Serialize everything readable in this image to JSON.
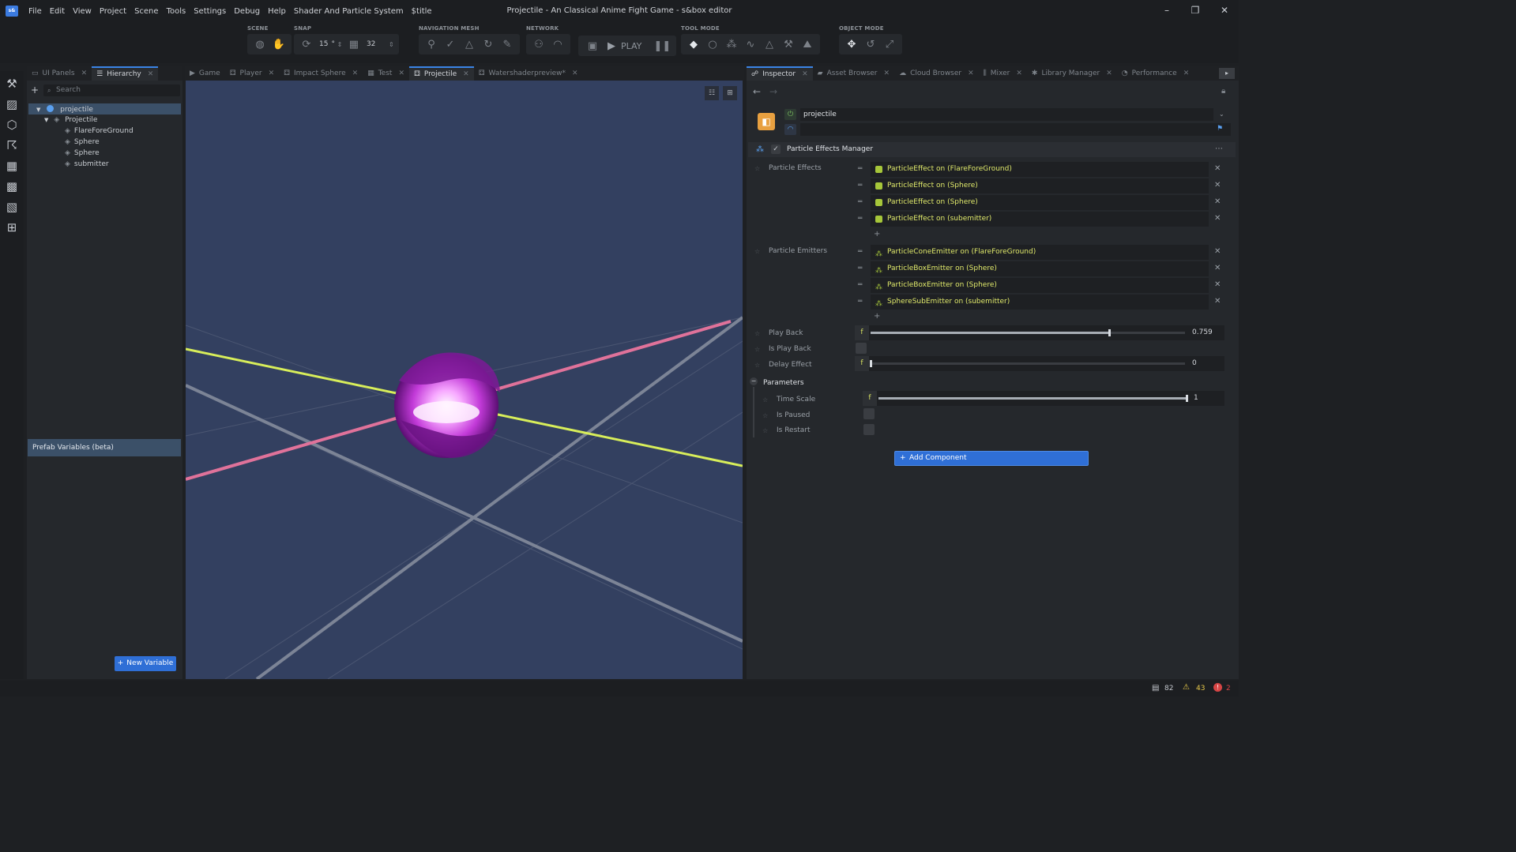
{
  "app": {
    "logo_text": "s&",
    "window_title": "Projectile - An Classical Anime Fight Game - s&box editor",
    "menu": [
      "File",
      "Edit",
      "View",
      "Project",
      "Scene",
      "Tools",
      "Settings",
      "Debug",
      "Help",
      "Shader And Particle System",
      "$title"
    ]
  },
  "toolbar": {
    "groups": {
      "scene": "SCENE",
      "snap": "SNAP",
      "navmesh": "NAVIGATION MESH",
      "network": "NETWORK",
      "toolmode": "TOOL MODE",
      "objectmode": "OBJECT MODE"
    },
    "snap_angle": "15",
    "snap_angle_unit": "°",
    "snap_grid": "32",
    "play_label": "PLAY"
  },
  "hierarchy_panel": {
    "tabs": [
      "UI Panels",
      "Hierarchy"
    ],
    "active_tab": "Hierarchy",
    "search_placeholder": "Search",
    "tree": [
      {
        "label": "projectile",
        "depth": 0,
        "selected": true
      },
      {
        "label": "Projectile",
        "depth": 1
      },
      {
        "label": "FlareForeGround",
        "depth": 2
      },
      {
        "label": "Sphere",
        "depth": 2
      },
      {
        "label": "Sphere",
        "depth": 2
      },
      {
        "label": "submitter",
        "depth": 2
      }
    ],
    "prefab_header": "Prefab Variables (beta)",
    "new_variable": "New Variable"
  },
  "viewport_tabs": [
    "Game",
    "Player",
    "Impact Sphere",
    "Test",
    "Projectile",
    "Watershaderpreview*"
  ],
  "viewport_active_tab": "Projectile",
  "inspector_tabs": [
    "Inspector",
    "Asset Browser",
    "Cloud Browser",
    "Mixer",
    "Library Manager",
    "Performance"
  ],
  "inspector": {
    "object_name": "projectile",
    "component_title": "Particle Effects Manager",
    "particle_effects_label": "Particle Effects",
    "particle_effects": [
      "ParticleEffect on (FlareForeGround)",
      "ParticleEffect on (Sphere)",
      "ParticleEffect on (Sphere)",
      "ParticleEffect on (subemitter)"
    ],
    "particle_emitters_label": "Particle Emitters",
    "particle_emitters": [
      "ParticleConeEmitter on (FlareForeGround)",
      "ParticleBoxEmitter on (Sphere)",
      "ParticleBoxEmitter on (Sphere)",
      "SphereSubEmitter on (subemitter)"
    ],
    "play_back_label": "Play Back",
    "play_back_value": "0.759",
    "play_back_fraction": 0.759,
    "is_play_back_label": "Is Play Back",
    "delay_effect_label": "Delay Effect",
    "delay_effect_value": "0",
    "delay_effect_fraction": 0,
    "parameters_label": "Parameters",
    "time_scale_label": "Time Scale",
    "time_scale_value": "1",
    "time_scale_fraction": 1,
    "is_paused_label": "Is Paused",
    "is_restart_label": "Is Restart",
    "add_component": "Add Component",
    "float_tag": "f"
  },
  "status": {
    "messages": "82",
    "warnings": "43",
    "errors": "2"
  },
  "colors": {
    "accent": "#3a84e6",
    "viewport_bg": "#334060",
    "ref_text": "#dfe86a",
    "axis_x": "#e0729a",
    "axis_z": "#d8ee5a"
  }
}
